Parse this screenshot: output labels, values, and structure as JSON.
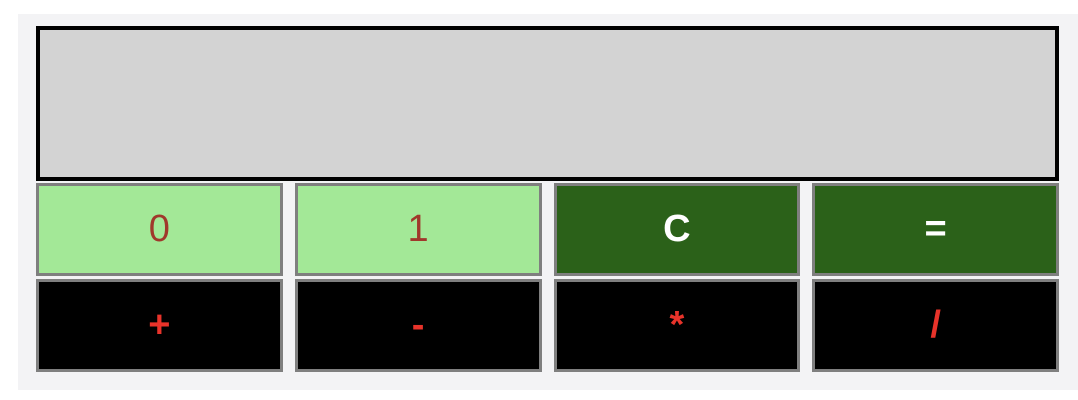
{
  "calculator": {
    "display_value": "",
    "keys": {
      "zero": "0",
      "one": "1",
      "clear": "C",
      "equals": "=",
      "plus": "+",
      "minus": "-",
      "multiply": "*",
      "divide": "/"
    }
  },
  "colors": {
    "display_bg": "#d3d3d3",
    "digit_bg": "#a3e897",
    "digit_text": "#a0382b",
    "control_bg": "#2b6119",
    "control_text": "#ffffff",
    "operator_bg": "#000000",
    "operator_text": "#e8332a"
  }
}
